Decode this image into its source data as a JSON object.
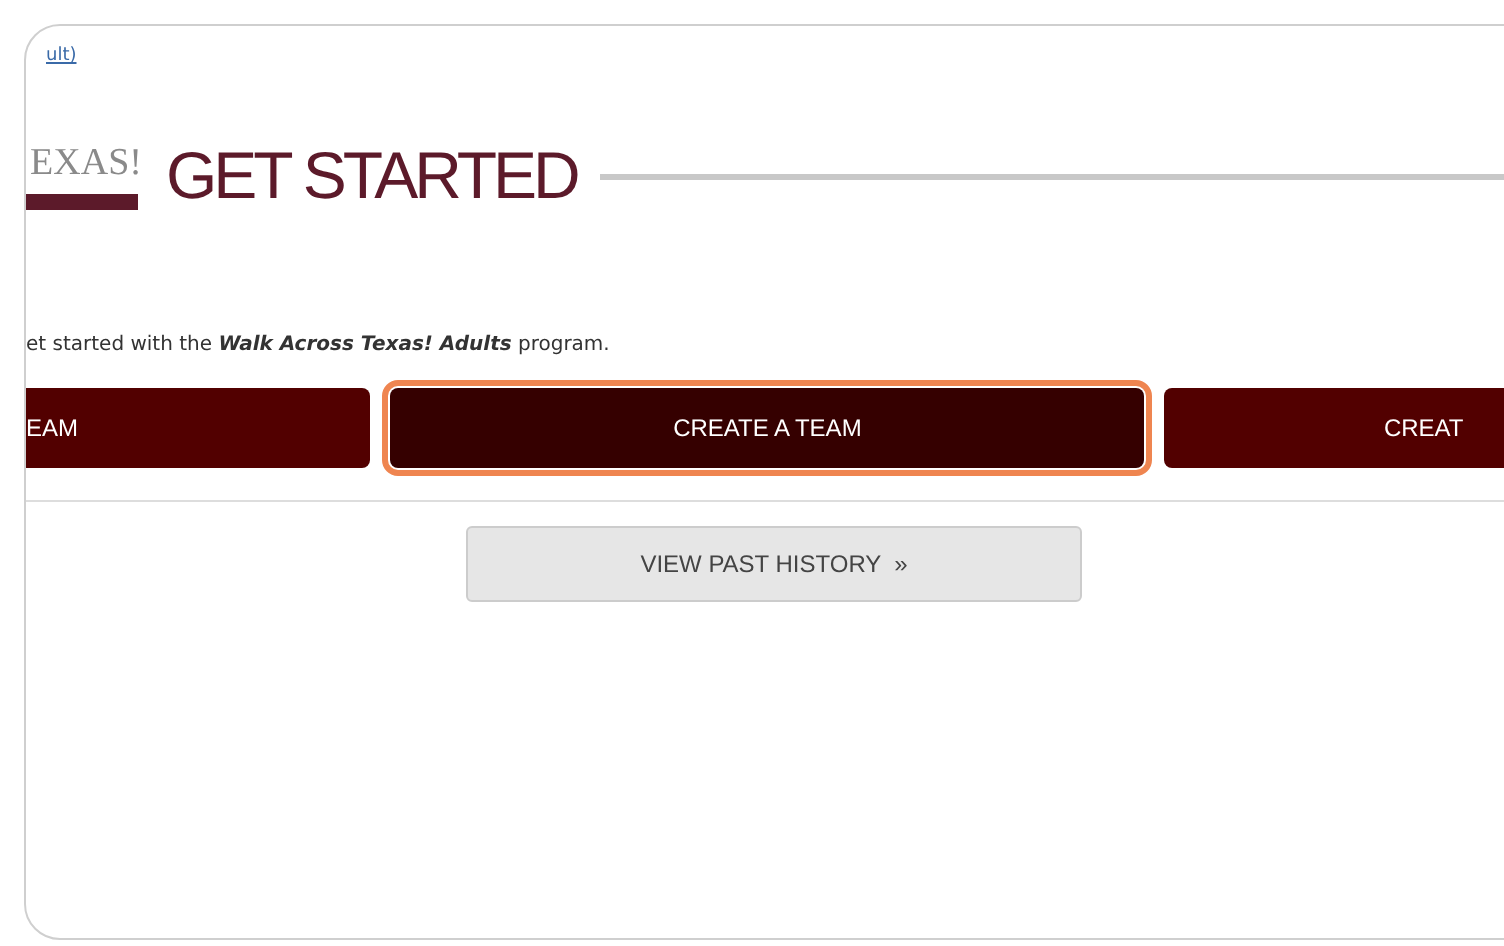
{
  "top_link": "ult)",
  "logo": {
    "text": "EXAS!"
  },
  "heading": "GET STARTED",
  "intro": "et started with the **Walk Across Texas! Adults** program.",
  "buttons": [
    {
      "label": "EAM",
      "focused": false
    },
    {
      "label": "CREATE A TEAM",
      "focused": true
    },
    {
      "label": "CREAT",
      "focused": false
    }
  ],
  "history_button": "VIEW PAST HISTORY  »"
}
